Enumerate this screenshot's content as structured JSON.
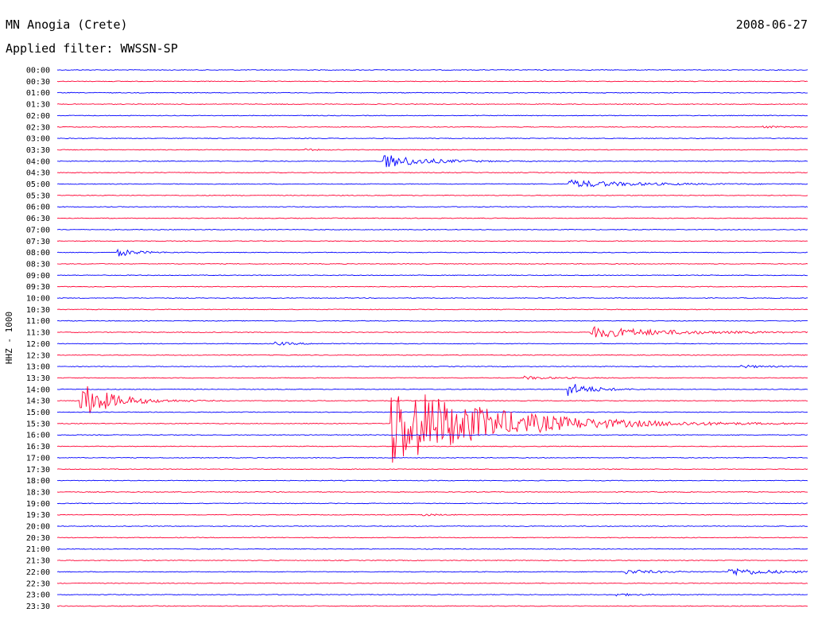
{
  "header": {
    "station": "MN Anogia (Crete)",
    "date": "2008-06-27",
    "filter_label": "Applied filter: WWSSN-SP"
  },
  "chart_data": {
    "type": "line",
    "title": "MN Anogia (Crete)",
    "date": "2008-06-27",
    "ylabel": "HHZ - 1000",
    "trace_colors": [
      "#0000ff",
      "#ff0033"
    ],
    "rows": [
      {
        "label": "00:00",
        "events": []
      },
      {
        "label": "00:30",
        "events": []
      },
      {
        "label": "01:00",
        "events": []
      },
      {
        "label": "01:30",
        "events": []
      },
      {
        "label": "02:00",
        "events": []
      },
      {
        "label": "02:30",
        "events": [
          {
            "pos": 0.94,
            "amp": 1.2,
            "dur": 0.025
          }
        ]
      },
      {
        "label": "03:00",
        "events": []
      },
      {
        "label": "03:30",
        "events": [
          {
            "pos": 0.33,
            "amp": 1.3,
            "dur": 0.015
          }
        ]
      },
      {
        "label": "04:00",
        "events": [
          {
            "pos": 0.435,
            "amp": 9,
            "dur": 0.05
          }
        ]
      },
      {
        "label": "04:30",
        "events": []
      },
      {
        "label": "05:00",
        "events": [
          {
            "pos": 0.68,
            "amp": 5,
            "dur": 0.08
          }
        ]
      },
      {
        "label": "05:30",
        "events": []
      },
      {
        "label": "06:00",
        "events": []
      },
      {
        "label": "06:30",
        "events": []
      },
      {
        "label": "07:00",
        "events": []
      },
      {
        "label": "07:30",
        "events": []
      },
      {
        "label": "08:00",
        "events": [
          {
            "pos": 0.08,
            "amp": 5,
            "dur": 0.025
          }
        ]
      },
      {
        "label": "08:30",
        "events": []
      },
      {
        "label": "09:00",
        "events": []
      },
      {
        "label": "09:30",
        "events": []
      },
      {
        "label": "10:00",
        "events": []
      },
      {
        "label": "10:30",
        "events": []
      },
      {
        "label": "11:00",
        "events": []
      },
      {
        "label": "11:30",
        "events": [
          {
            "pos": 0.71,
            "amp": 7,
            "dur": 0.1
          }
        ]
      },
      {
        "label": "12:00",
        "events": [
          {
            "pos": 0.29,
            "amp": 2,
            "dur": 0.03
          }
        ]
      },
      {
        "label": "12:30",
        "events": []
      },
      {
        "label": "13:00",
        "events": [
          {
            "pos": 0.91,
            "amp": 2,
            "dur": 0.03
          }
        ]
      },
      {
        "label": "13:30",
        "events": [
          {
            "pos": 0.62,
            "amp": 2,
            "dur": 0.04
          }
        ]
      },
      {
        "label": "14:00",
        "events": [
          {
            "pos": 0.68,
            "amp": 9,
            "dur": 0.03
          }
        ]
      },
      {
        "label": "14:30",
        "events": [
          {
            "pos": 0.03,
            "amp": 24,
            "dur": 0.04
          }
        ]
      },
      {
        "label": "15:00",
        "events": []
      },
      {
        "label": "15:30",
        "events": [
          {
            "pos": 0.445,
            "amp": 55,
            "dur": 0.12
          }
        ]
      },
      {
        "label": "16:00",
        "events": []
      },
      {
        "label": "16:30",
        "events": []
      },
      {
        "label": "17:00",
        "events": []
      },
      {
        "label": "17:30",
        "events": []
      },
      {
        "label": "18:00",
        "events": []
      },
      {
        "label": "18:30",
        "events": []
      },
      {
        "label": "19:00",
        "events": []
      },
      {
        "label": "19:30",
        "events": [
          {
            "pos": 0.485,
            "amp": 1.5,
            "dur": 0.02
          }
        ]
      },
      {
        "label": "20:00",
        "events": []
      },
      {
        "label": "20:30",
        "events": []
      },
      {
        "label": "21:00",
        "events": []
      },
      {
        "label": "21:30",
        "events": []
      },
      {
        "label": "22:00",
        "events": [
          {
            "pos": 0.755,
            "amp": 3,
            "dur": 0.04
          },
          {
            "pos": 0.895,
            "amp": 5,
            "dur": 0.05
          }
        ]
      },
      {
        "label": "22:30",
        "events": []
      },
      {
        "label": "23:00",
        "events": [
          {
            "pos": 0.745,
            "amp": 1.5,
            "dur": 0.03
          }
        ]
      },
      {
        "label": "23:30",
        "events": []
      }
    ]
  }
}
